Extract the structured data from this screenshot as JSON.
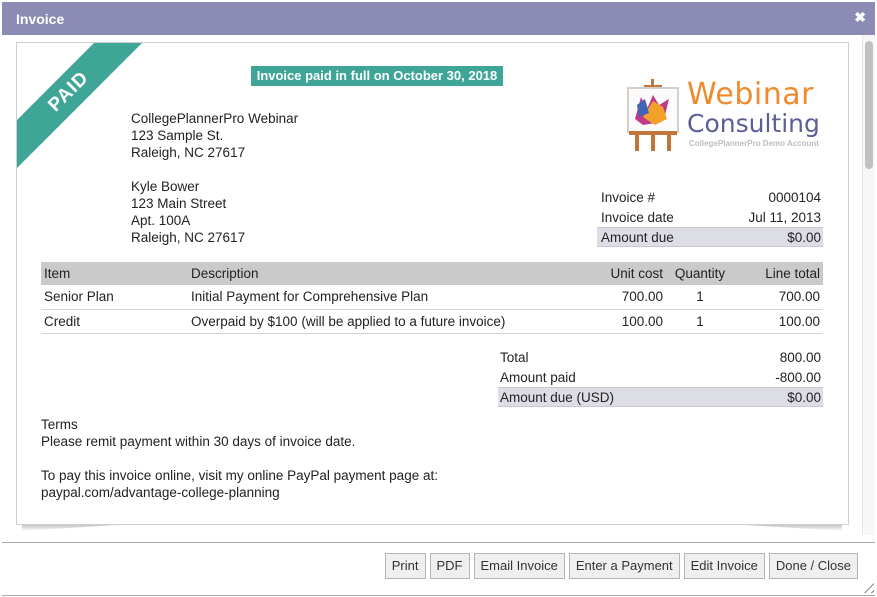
{
  "dialog": {
    "title": "Invoice",
    "close_icon": "close-icon"
  },
  "invoice": {
    "status_ribbon": "PAID",
    "paid_banner": "Invoice paid in full on October 30, 2018",
    "from": {
      "name": "CollegePlannerPro Webinar",
      "street": "123 Sample St.",
      "city": "Raleigh, NC 27617"
    },
    "to": {
      "name": "Kyle Bower",
      "street": "123 Main Street",
      "apt": "Apt. 100A",
      "city": "Raleigh, NC 27617"
    },
    "logo": {
      "line1": "Webinar",
      "line2": "Consulting",
      "line3": "CollegePlannerPro Demo Account",
      "icon": "easel-icon",
      "colors": {
        "orange": "#ef8b2c",
        "purple": "#5e5e97"
      }
    },
    "meta": [
      {
        "label": "Invoice #",
        "value": "0000104"
      },
      {
        "label": "Invoice date",
        "value": "Jul 11, 2013"
      },
      {
        "label": "Amount due",
        "value": "$0.00"
      }
    ],
    "table": {
      "headers": [
        "Item",
        "Description",
        "Unit cost",
        "Quantity",
        "Line total"
      ],
      "rows": [
        {
          "item": "Senior Plan",
          "description": "Initial Payment for Comprehensive Plan",
          "unit_cost": "700.00",
          "quantity": "1",
          "line_total": "700.00"
        },
        {
          "item": "Credit",
          "description": "Overpaid by $100 (will be applied to a future invoice)",
          "unit_cost": "100.00",
          "quantity": "1",
          "line_total": "100.00"
        }
      ]
    },
    "totals": [
      {
        "label": "Total",
        "value": "800.00"
      },
      {
        "label": "Amount paid",
        "value": "-800.00"
      },
      {
        "label": "Amount due (USD)",
        "value": "$0.00"
      }
    ],
    "terms": {
      "heading": "Terms",
      "text": "Please remit payment within 30 days of invoice date.",
      "paypal_text": "To pay this invoice online, visit my online PayPal payment page at:",
      "paypal_link": "paypal.com/advantage-college-planning"
    },
    "accent_color": "#3ea597"
  },
  "footer": {
    "buttons": [
      "Print",
      "PDF",
      "Email Invoice",
      "Enter a Payment",
      "Edit Invoice",
      "Done / Close"
    ]
  }
}
